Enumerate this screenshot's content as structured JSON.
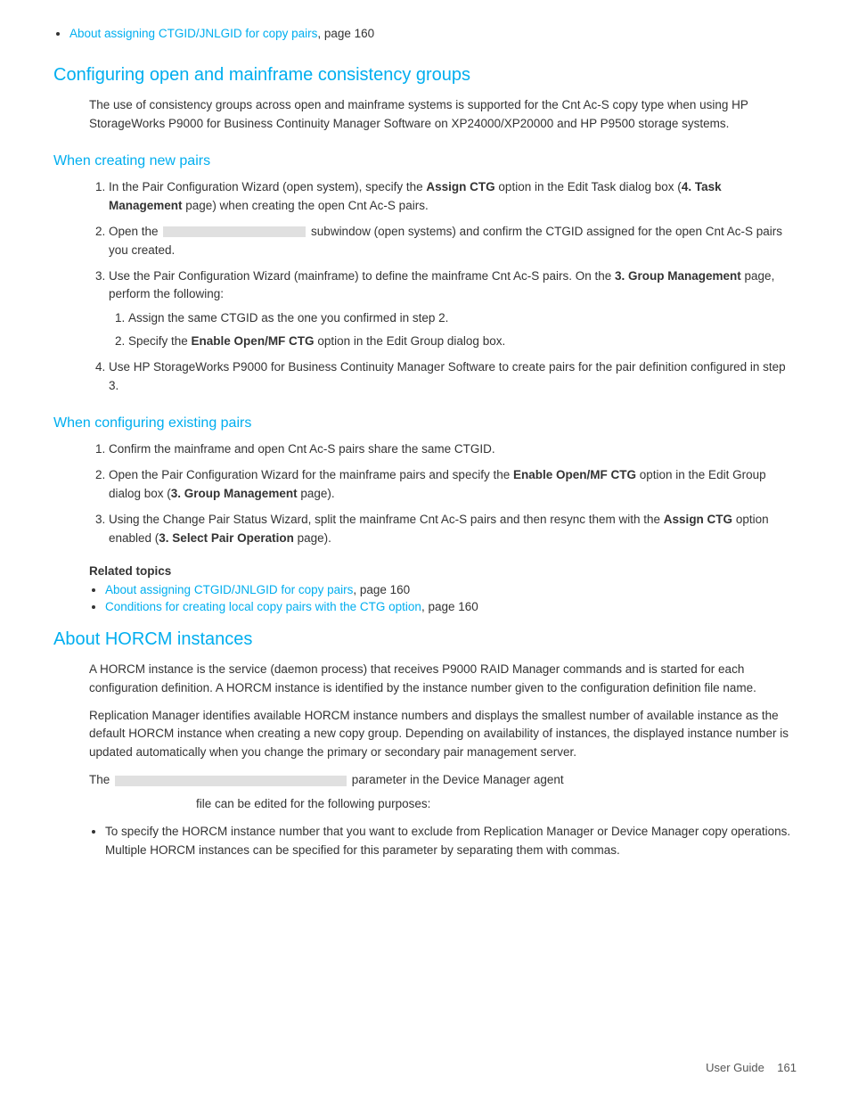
{
  "top_link": {
    "text": "About assigning CTGID/JNLGID for copy pairs",
    "page": "page 160"
  },
  "section1": {
    "heading": "Configuring open and mainframe consistency groups",
    "intro": "The use of consistency groups across open and mainframe systems is supported for the Cnt Ac-S copy type when using HP StorageWorks P9000 for Business Continuity Manager Software on XP24000/XP20000 and HP P9500 storage systems.",
    "sub1": {
      "heading": "When creating new pairs",
      "steps": [
        {
          "id": "1",
          "text_before": "In the Pair Configuration Wizard (open system), specify the ",
          "bold": "Assign CTG",
          "text_after": " option in the Edit Task dialog box (",
          "bold2": "4. Task Management",
          "text_after2": " page) when creating the open Cnt Ac-S pairs."
        },
        {
          "id": "2",
          "text_before": "Open the",
          "placeholder": true,
          "text_after": " subwindow (open systems) and confirm the CTGID assigned for the open Cnt Ac-S pairs you created."
        },
        {
          "id": "3",
          "text_before": "Use the Pair Configuration Wizard (mainframe) to define the mainframe Cnt Ac-S pairs. On the ",
          "bold": "3. Group Management",
          "text_after": " page, perform the following:",
          "sub_steps": [
            {
              "id": "1",
              "text": "Assign the same CTGID as the one you confirmed in step 2."
            },
            {
              "id": "2",
              "text_before": "Specify the ",
              "bold": "Enable Open/MF CTG",
              "text_after": " option in the Edit Group dialog box."
            }
          ]
        },
        {
          "id": "4",
          "text": "Use HP StorageWorks P9000 for Business Continuity Manager Software to create pairs for the pair definition configured in step 3."
        }
      ]
    },
    "sub2": {
      "heading": "When configuring existing pairs",
      "steps": [
        {
          "id": "1",
          "text": "Confirm the mainframe and open Cnt Ac-S pairs share the same CTGID."
        },
        {
          "id": "2",
          "text_before": "Open the Pair Configuration Wizard for the mainframe pairs and specify the ",
          "bold": "Enable Open/MF CTG",
          "text_after": " option in the Edit Group dialog box (",
          "bold2": "3. Group Management",
          "text_after2": " page)."
        },
        {
          "id": "3",
          "text_before": "Using the Change Pair Status Wizard, split the mainframe Cnt Ac-S pairs and then resync them with the ",
          "bold": "Assign CTG",
          "text_after": " option enabled (",
          "bold2": "3. Select Pair Operation",
          "text_after2": " page)."
        }
      ],
      "related_topics_label": "Related topics",
      "related_links": [
        {
          "text": "About assigning CTGID/JNLGID for copy pairs",
          "page": "page 160"
        },
        {
          "text": "Conditions for creating local copy pairs with the CTG option",
          "page": "page 160"
        }
      ]
    }
  },
  "section2": {
    "heading": "About HORCM instances",
    "para1": "A HORCM instance is the service (daemon process) that receives P9000 RAID Manager commands and is started for each configuration definition. A HORCM instance is identified by the instance number given to the configuration definition file name.",
    "para2": "Replication Manager identifies available HORCM instance numbers and displays the smallest number of available instance as the default HORCM instance when creating a new copy group. Depending on availability of instances, the displayed instance number is updated automatically when you change the primary or secondary pair management server.",
    "para3_before": "The",
    "para3_after": " parameter in the Device Manager agent",
    "para3_file": "file can be edited for the following purposes:",
    "bullets": [
      "To specify the HORCM instance number that you want to exclude from Replication Manager or Device Manager copy operations. Multiple HORCM instances can be specified for this parameter by separating them with commas."
    ]
  },
  "footer": {
    "label": "User Guide",
    "page_number": "161"
  }
}
